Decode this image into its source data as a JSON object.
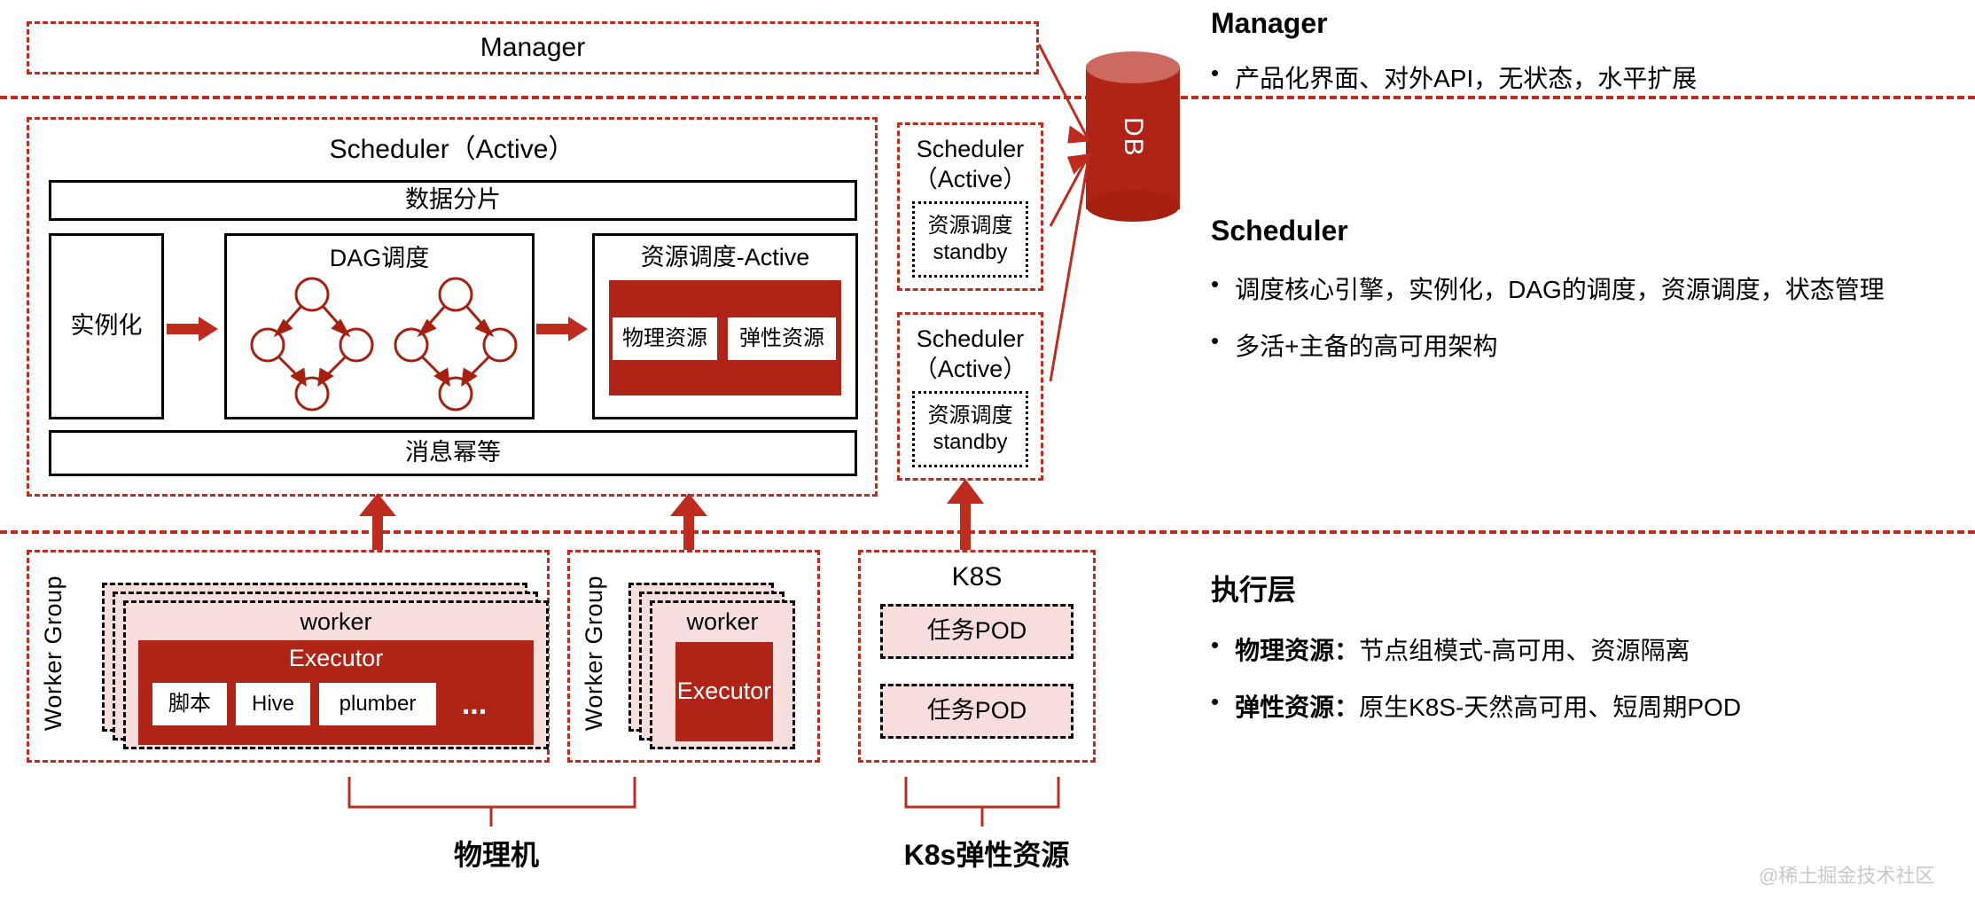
{
  "layers": {
    "manager": {
      "box_label": "Manager"
    },
    "scheduler": {
      "main_title": "Scheduler（Active）",
      "sharding": "数据分片",
      "instancing": "实例化",
      "dag_title": "DAG调度",
      "resource_title": "资源调度-Active",
      "physical_resource": "物理资源",
      "elastic_resource": "弹性资源",
      "idempotent": "消息幂等",
      "standby_nodes": [
        {
          "title_line1": "Scheduler",
          "title_line2": "（Active）",
          "inner_line1": "资源调度",
          "inner_line2": "standby"
        },
        {
          "title_line1": "Scheduler",
          "title_line2": "（Active）",
          "inner_line1": "资源调度",
          "inner_line2": "standby"
        }
      ]
    },
    "execution": {
      "worker_group_label": "Worker Group",
      "worker_label": "worker",
      "executor_label": "Executor",
      "task_types": [
        "脚本",
        "Hive",
        "plumber"
      ],
      "ellipsis": "...",
      "k8s_title": "K8S",
      "pods": [
        "任务POD",
        "任务POD"
      ],
      "brace_labels": [
        "物理机",
        "K8s弹性资源"
      ]
    }
  },
  "database": {
    "label": "DB"
  },
  "side_panel": {
    "sections": [
      {
        "heading": "Manager",
        "bullets": [
          {
            "bold": "",
            "text": "产品化界面、对外API，无状态，水平扩展"
          }
        ]
      },
      {
        "heading": "Scheduler",
        "bullets": [
          {
            "bold": "",
            "text": "调度核心引擎，实例化，DAG的调度，资源调度，状态管理"
          },
          {
            "bold": "",
            "text": "多活+主备的高可用架构"
          }
        ]
      },
      {
        "heading": "执行层",
        "bullets": [
          {
            "bold": "物理资源：",
            "text": "节点组模式-高可用、资源隔离"
          },
          {
            "bold": "弹性资源：",
            "text": "原生K8S-天然高可用、短周期POD"
          }
        ]
      }
    ]
  },
  "watermark": {
    "text": "@稀土掘金技术社区"
  },
  "colors": {
    "accent_red": "#BF2C1E",
    "fill_red": "#B02418",
    "pink": "#F7DEDD",
    "black": "#000000"
  }
}
